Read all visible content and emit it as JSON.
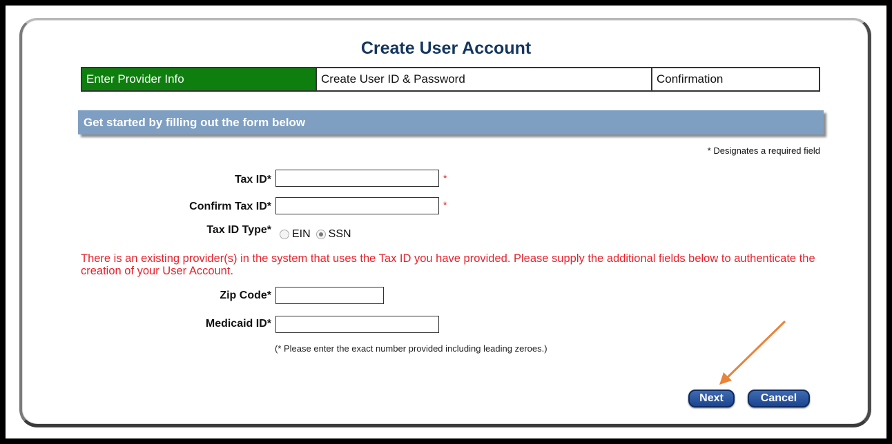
{
  "page": {
    "title": "Create User Account",
    "steps": [
      {
        "label": "Enter Provider Info",
        "active": true
      },
      {
        "label": "Create User ID & Password",
        "active": false
      },
      {
        "label": "Confirmation",
        "active": false
      }
    ],
    "banner": "Get started by filling out the form below",
    "required_note": "* Designates a required field"
  },
  "form": {
    "tax_id": {
      "label": "Tax ID*",
      "value": "",
      "required_mark": "*"
    },
    "confirm_tax_id": {
      "label": "Confirm Tax ID*",
      "value": "",
      "required_mark": "*"
    },
    "tax_id_type": {
      "label": "Tax ID Type*",
      "options": [
        {
          "label": "EIN",
          "checked": false
        },
        {
          "label": "SSN",
          "checked": true
        }
      ]
    },
    "warning": "There is an existing provider(s) in the system that uses the Tax ID you have provided. Please supply the additional fields below to authenticate the creation of your User Account.",
    "zip_code": {
      "label": "Zip Code*",
      "value": ""
    },
    "medicaid_id": {
      "label": "Medicaid ID*",
      "value": ""
    },
    "medicaid_hint": "(* Please enter the exact number provided including leading zeroes.)"
  },
  "buttons": {
    "next": "Next",
    "cancel": "Cancel"
  },
  "colors": {
    "active_step": "#0e7f0e",
    "banner": "#7e9fc2",
    "warning_text": "#e8202a",
    "title": "#14365f",
    "annotation_arrow": "#e8843a"
  }
}
